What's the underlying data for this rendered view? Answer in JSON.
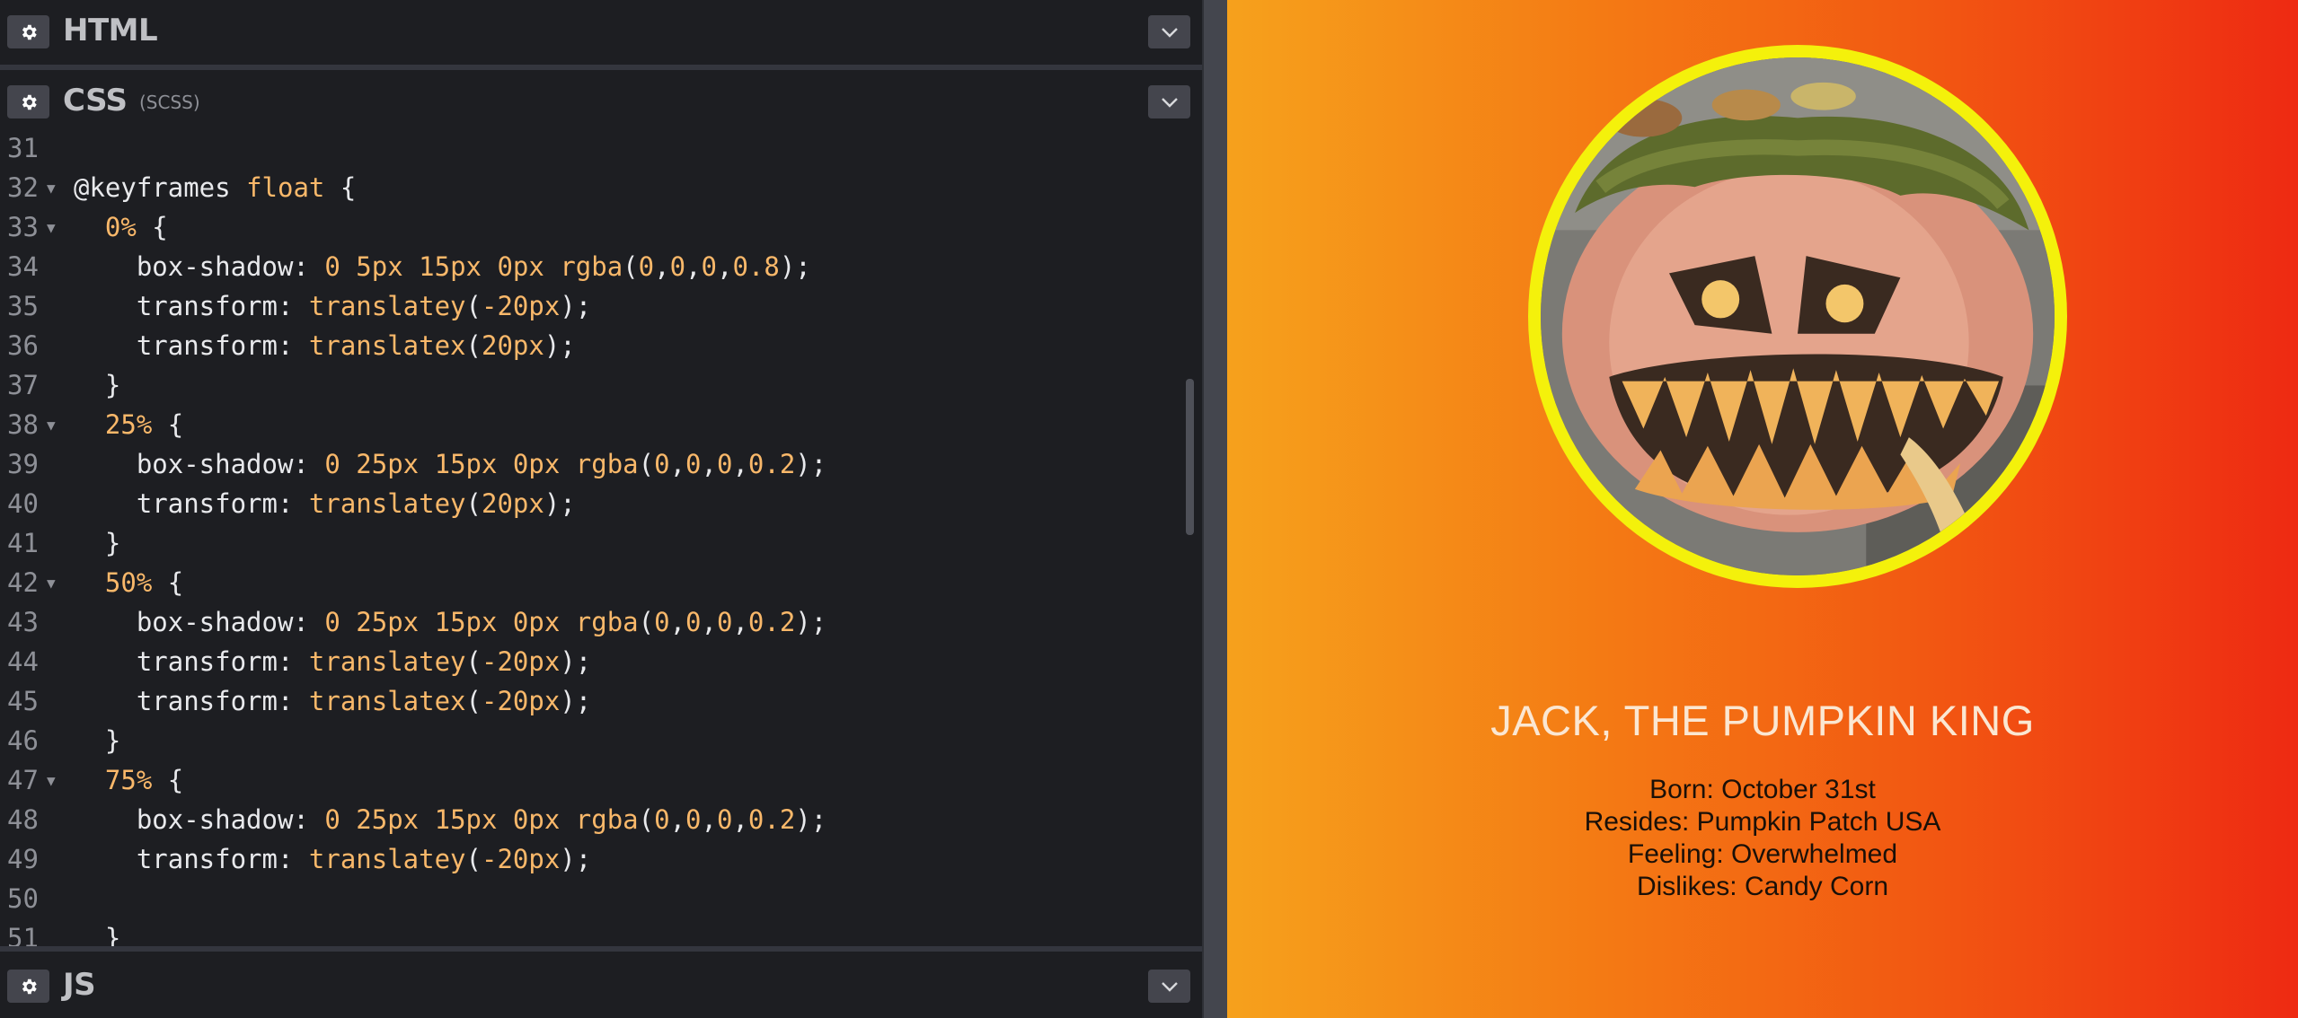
{
  "panels": {
    "html": {
      "title": "HTML"
    },
    "css": {
      "title": "CSS",
      "subtitle": "(SCSS)"
    },
    "js": {
      "title": "JS"
    }
  },
  "icons": {
    "settings": "gear-icon",
    "collapse": "chevron-down-icon"
  },
  "code_lines": [
    {
      "n": "31",
      "fold": false,
      "text": ""
    },
    {
      "n": "32",
      "fold": true,
      "text": "@keyframes float {"
    },
    {
      "n": "33",
      "fold": true,
      "text": "  0% {"
    },
    {
      "n": "34",
      "fold": false,
      "text": "    box-shadow: 0 5px 15px 0px rgba(0,0,0,0.8);"
    },
    {
      "n": "35",
      "fold": false,
      "text": "    transform: translatey(-20px);"
    },
    {
      "n": "36",
      "fold": false,
      "text": "    transform: translatex(20px);"
    },
    {
      "n": "37",
      "fold": false,
      "text": "  }"
    },
    {
      "n": "38",
      "fold": true,
      "text": "  25% {"
    },
    {
      "n": "39",
      "fold": false,
      "text": "    box-shadow: 0 25px 15px 0px rgba(0,0,0,0.2);"
    },
    {
      "n": "40",
      "fold": false,
      "text": "    transform: translatey(20px);"
    },
    {
      "n": "41",
      "fold": false,
      "text": "  }"
    },
    {
      "n": "42",
      "fold": true,
      "text": "  50% {"
    },
    {
      "n": "43",
      "fold": false,
      "text": "    box-shadow: 0 25px 15px 0px rgba(0,0,0,0.2);"
    },
    {
      "n": "44",
      "fold": false,
      "text": "    transform: translatey(-20px);"
    },
    {
      "n": "45",
      "fold": false,
      "text": "    transform: translatex(-20px);"
    },
    {
      "n": "46",
      "fold": false,
      "text": "  }"
    },
    {
      "n": "47",
      "fold": true,
      "text": "  75% {"
    },
    {
      "n": "48",
      "fold": false,
      "text": "    box-shadow: 0 25px 15px 0px rgba(0,0,0,0.2);"
    },
    {
      "n": "49",
      "fold": false,
      "text": "    transform: translatey(-20px);"
    },
    {
      "n": "50",
      "fold": false,
      "text": ""
    },
    {
      "n": "51",
      "fold": false,
      "text": "  }"
    }
  ],
  "preview": {
    "title": "JACK, THE PUMPKIN KING",
    "facts": [
      "Born: October 31st",
      "Resides: Pumpkin Patch USA",
      "Feeling: Overwhelmed",
      "Dislikes: Candy Corn"
    ],
    "ring_color": "#f4f10b"
  },
  "colors": {
    "editor_bg": "#1d1e22",
    "number_token": "#f9b86a",
    "gradient_start": "#f6a11c",
    "gradient_end": "#ee2a12"
  }
}
